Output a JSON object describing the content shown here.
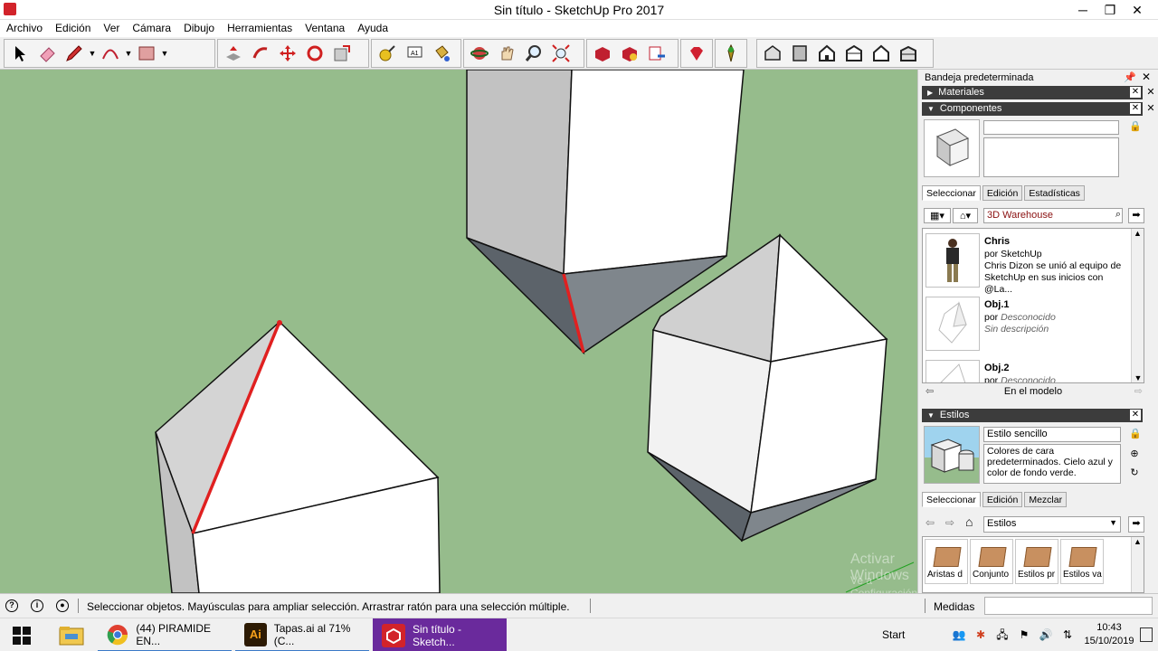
{
  "window": {
    "title": "Sin título - SketchUp Pro 2017",
    "minimize": "─",
    "maximize": "❐",
    "close": "✕"
  },
  "menu": [
    "Archivo",
    "Edición",
    "Ver",
    "Cámara",
    "Dibujo",
    "Herramientas",
    "Ventana",
    "Ayuda"
  ],
  "toolbar": {
    "groups": [
      {
        "tools": [
          "select-tool",
          "eraser-tool",
          "pencil-tool",
          "arc-tool",
          "rectangle-tool"
        ]
      },
      {
        "tools": [
          "push-pull-tool",
          "follow-me-tool",
          "move-tool",
          "rotate-tool",
          "scale-tool"
        ]
      },
      {
        "tools": [
          "tape-measure-tool",
          "text-tool",
          "paint-bucket-tool"
        ]
      },
      {
        "tools": [
          "orbit-tool",
          "pan-tool",
          "zoom-tool",
          "zoom-extents-tool"
        ]
      },
      {
        "tools": [
          "3d-warehouse-icon",
          "extension-warehouse-icon",
          "send-to-layout-icon"
        ]
      },
      {
        "tools": [
          "ruby-icon"
        ]
      },
      {
        "tools": [
          "add-location-icon"
        ]
      },
      {
        "tools": [
          "iso-view-icon",
          "top-view-icon",
          "front-view-icon",
          "right-view-icon",
          "back-view-icon",
          "left-view-icon"
        ]
      }
    ]
  },
  "tray": {
    "title": "Bandeja predeterminada",
    "materials": {
      "title": "Materiales"
    },
    "components": {
      "title": "Componentes",
      "name_value": "",
      "desc_value": "",
      "tabs": [
        "Seleccionar",
        "Edición",
        "Estadísticas"
      ],
      "search_value": "3D Warehouse",
      "items": [
        {
          "title": "Chris",
          "by": "por SketchUp",
          "desc": "Chris Dizon se unió al equipo de SketchUp en sus inicios con @La..."
        },
        {
          "title": "Obj.1",
          "by_prefix": "por",
          "by_name": "Desconocido",
          "desc": "Sin descripción"
        },
        {
          "title": "Obj.2",
          "by_prefix": "por",
          "by_name": "Desconocido",
          "desc": ""
        }
      ],
      "footer": "En el modelo"
    },
    "styles": {
      "title": "Estilos",
      "name_value": "Estilo sencillo",
      "desc_value": "Colores de cara predeterminados. Cielo azul y color de fondo verde.",
      "tabs": [
        "Seleccionar",
        "Edición",
        "Mezclar"
      ],
      "collection_value": "Estilos",
      "cells": [
        "Aristas d",
        "Conjunto",
        "Estilos pr",
        "Estilos va"
      ]
    }
  },
  "statusbar": {
    "text": "Seleccionar objetos. Mayúsculas para ampliar selección. Arrastrar ratón para una selección múltiple.",
    "measurements_label": "Medidas",
    "measurements_value": ""
  },
  "watermark": {
    "line1": "Activar Windows",
    "line2": "Ve a Configuración de PC para activar Windows."
  },
  "taskbar": {
    "tasks": [
      {
        "label": "(44) PIRAMIDE EN..."
      },
      {
        "label": "Tapas.ai al 71% (C..."
      },
      {
        "label": "Sin título - Sketch..."
      }
    ],
    "start_label": "Start",
    "time": "10:43",
    "date": "15/10/2019"
  },
  "colors": {
    "background_green": "#96bc8c",
    "selection_red": "#e02020",
    "panel_dark": "#3c3c3c",
    "taskbar_active": "#6a2a9c"
  }
}
